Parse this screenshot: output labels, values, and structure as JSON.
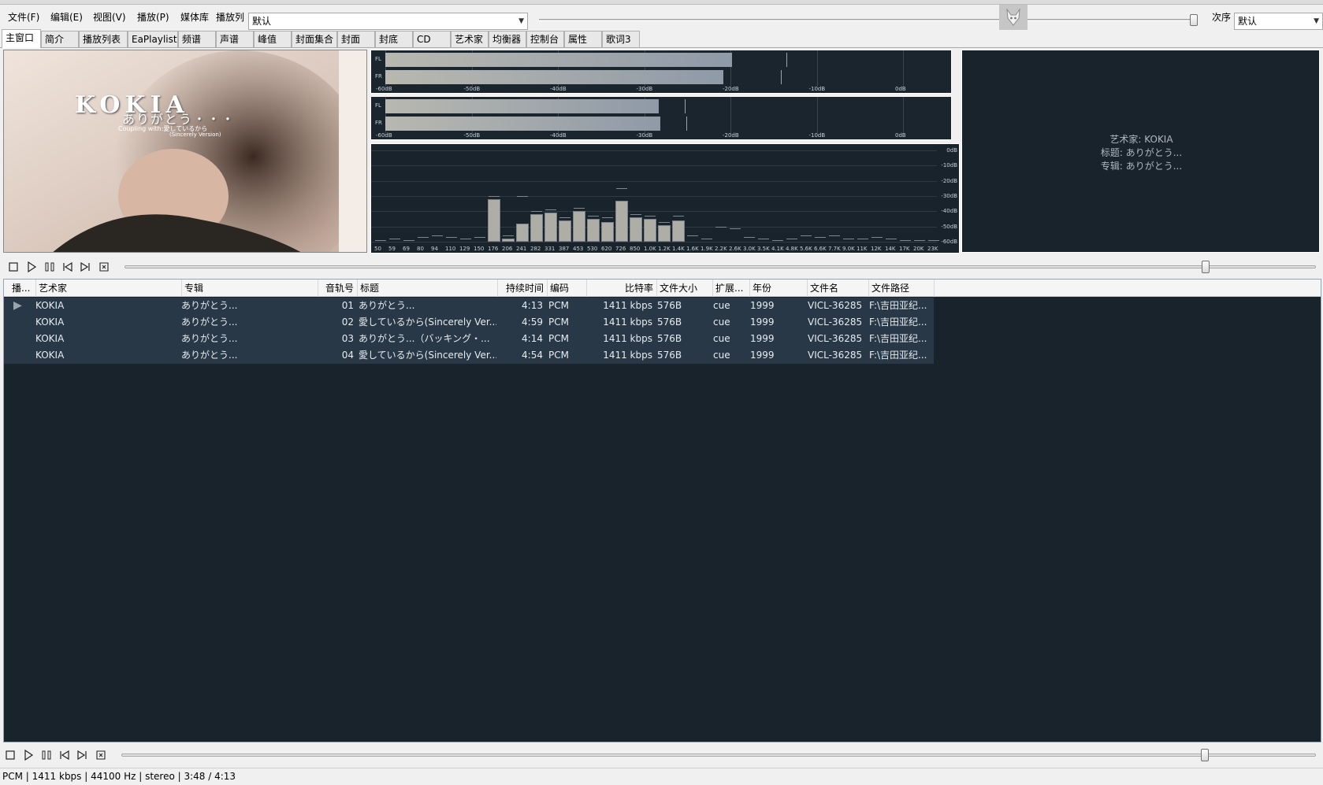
{
  "menu": {
    "file": "文件(F)",
    "edit": "编辑(E)",
    "view": "视图(V)",
    "playback": "播放(P)",
    "library": "媒体库",
    "playlist_label": "播放列",
    "playlist_value": "默认",
    "order_label": "次序",
    "order_value": "默认"
  },
  "tabs": [
    "主窗口",
    "简介",
    "播放列表",
    "EaPlaylist",
    "频谱",
    "声谱",
    "峰值",
    "封面集合",
    "封面",
    "封底",
    "CD",
    "艺术家",
    "均衡器",
    "控制台",
    "属性",
    "歌词3"
  ],
  "album_art": {
    "title": "KOKIA",
    "subtitle": "ありがとう・・・",
    "coupling": "Coupling with:愛しているから",
    "version": "(Sincerely Version)"
  },
  "vu": {
    "meter1": {
      "fl_db": -19.8,
      "fr_db": -20.8,
      "fl_peak_db": -13.5,
      "fr_peak_db": -14.2
    },
    "meter2": {
      "fl_db": -28.3,
      "fr_db": -28.1,
      "fl_peak_db": -25.3,
      "fr_peak_db": -25.1
    },
    "channel_labels": [
      "FL",
      "FR"
    ],
    "ticks": [
      "-60dB",
      "-50dB",
      "-40dB",
      "-30dB",
      "-20dB",
      "-10dB",
      "0dB"
    ]
  },
  "spectrum": {
    "db_ticks": [
      "0dB",
      "-10dB",
      "-20dB",
      "-30dB",
      "-40dB",
      "-50dB",
      "-60dB"
    ],
    "freq_labels": [
      "50",
      "59",
      "69",
      "80",
      "94",
      "110",
      "129",
      "150",
      "176",
      "206",
      "241",
      "282",
      "331",
      "387",
      "453",
      "530",
      "620",
      "726",
      "850",
      "1.0K",
      "1.2K",
      "1.4K",
      "1.6K",
      "1.9K",
      "2.2K",
      "2.6K",
      "3.0K",
      "3.5K",
      "4.1K",
      "4.8K",
      "5.6K",
      "6.6K",
      "7.7K",
      "9.0K",
      "11K",
      "12K",
      "14K",
      "17K",
      "20K",
      "23K"
    ],
    "levels_db": [
      -60,
      -60,
      -60,
      -60,
      -60,
      -60,
      -60,
      -60,
      -32,
      -58,
      -48,
      -42,
      -41,
      -46,
      -40,
      -45,
      -47,
      -33,
      -44,
      -45,
      -49,
      -46,
      -60,
      -60,
      -60,
      -60,
      -60,
      -60,
      -60,
      -60,
      -60,
      -60,
      -60,
      -60,
      -60,
      -60,
      -60,
      -60,
      -60,
      -60
    ],
    "peaks_db": [
      -59,
      -58,
      -59,
      -57,
      -56,
      -57,
      -58,
      -57,
      -30,
      -56,
      -30,
      -40,
      -39,
      -44,
      -38,
      -43,
      -44,
      -25,
      -42,
      -43,
      -47,
      -43,
      -56,
      -58,
      -50,
      -51,
      -57,
      -58,
      -59,
      -58,
      -56,
      -57,
      -56,
      -58,
      -58,
      -57,
      -58,
      -59,
      -59,
      -59
    ]
  },
  "info": {
    "artist": "艺术家: KOKIA",
    "title": "标题: ありがとう...",
    "album": "专辑: ありがとう..."
  },
  "seek": {
    "position_fraction": 0.91
  },
  "volume": {
    "level_fraction": 1.0
  },
  "playlist": {
    "columns": [
      "播...",
      "艺术家",
      "专辑",
      "音轨号",
      "标题",
      "持续时间",
      "编码",
      "比特率",
      "文件大小",
      "扩展...",
      "年份",
      "文件名",
      "文件路径"
    ],
    "rows": [
      {
        "playing": "▶",
        "artist": "KOKIA",
        "album": "ありがとう...",
        "track": "01",
        "title": "ありがとう...",
        "duration": "4:13",
        "codec": "PCM",
        "bitrate": "1411 kbps",
        "size": "576B",
        "ext": "cue",
        "year": "1999",
        "filename": "VICL-36285",
        "path": "F:\\吉田亚纪..."
      },
      {
        "playing": "",
        "artist": "KOKIA",
        "album": "ありがとう...",
        "track": "02",
        "title": "愛しているから(Sincerely Ver...",
        "duration": "4:59",
        "codec": "PCM",
        "bitrate": "1411 kbps",
        "size": "576B",
        "ext": "cue",
        "year": "1999",
        "filename": "VICL-36285",
        "path": "F:\\吉田亚纪..."
      },
      {
        "playing": "",
        "artist": "KOKIA",
        "album": "ありがとう...",
        "track": "03",
        "title": "ありがとう...（バッキング・...",
        "duration": "4:14",
        "codec": "PCM",
        "bitrate": "1411 kbps",
        "size": "576B",
        "ext": "cue",
        "year": "1999",
        "filename": "VICL-36285",
        "path": "F:\\吉田亚纪..."
      },
      {
        "playing": "",
        "artist": "KOKIA",
        "album": "ありがとう...",
        "track": "04",
        "title": "愛しているから(Sincerely Ver...",
        "duration": "4:54",
        "codec": "PCM",
        "bitrate": "1411 kbps",
        "size": "576B",
        "ext": "cue",
        "year": "1999",
        "filename": "VICL-36285",
        "path": "F:\\吉田亚纪..."
      }
    ]
  },
  "status": {
    "text": "PCM | 1411 kbps | 44100 Hz | stereo | 3:48 / 4:13"
  },
  "colors": {
    "panel_bg": "#18232b",
    "row_bg": "#283846",
    "row_text": "#e6ecf0",
    "bar_fill": "#aeaea6"
  }
}
